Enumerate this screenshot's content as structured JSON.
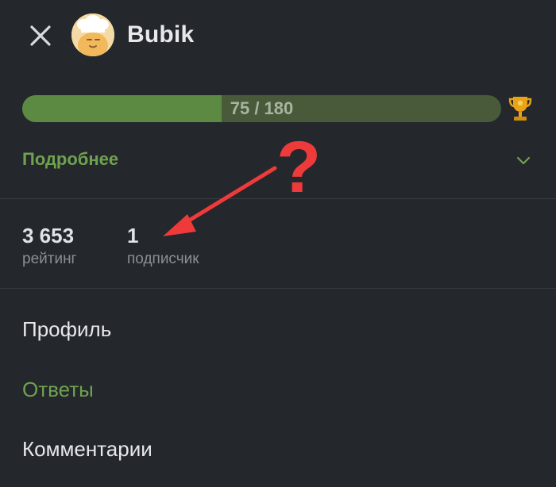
{
  "header": {
    "username": "Bubik"
  },
  "progress": {
    "label": "75 / 180",
    "current": 75,
    "total": 180
  },
  "details": {
    "label": "Подробнее"
  },
  "stats": {
    "rating": {
      "value": "3 653",
      "label": "рейтинг"
    },
    "subscribers": {
      "value": "1",
      "label": "подписчик"
    }
  },
  "menu": {
    "items": [
      {
        "label": "Профиль"
      },
      {
        "label": "Ответы"
      },
      {
        "label": "Комментарии"
      }
    ]
  },
  "annotation": {
    "question_mark": "?"
  },
  "colors": {
    "background": "#24272b",
    "accent_green": "#6fa24f",
    "progress_fill": "#5c8a43",
    "annotation_red": "#ee3a3a"
  }
}
